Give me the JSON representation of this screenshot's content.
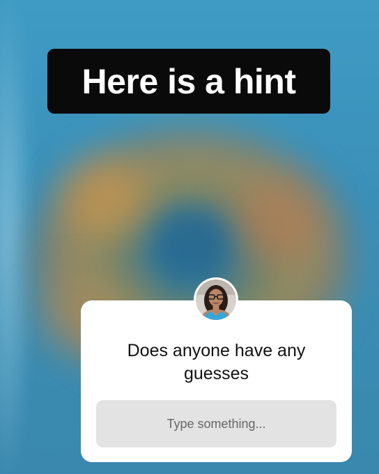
{
  "story": {
    "hint_text": "Here is a hint"
  },
  "question_sticker": {
    "question": "Does anyone have any guesses",
    "input_placeholder": "Type something...",
    "avatar_icon": "profile-avatar-icon"
  },
  "colors": {
    "background": "#3f9bc4",
    "banner": "#0a0a0a",
    "card": "#ffffff",
    "input": "#e3e3e3"
  }
}
